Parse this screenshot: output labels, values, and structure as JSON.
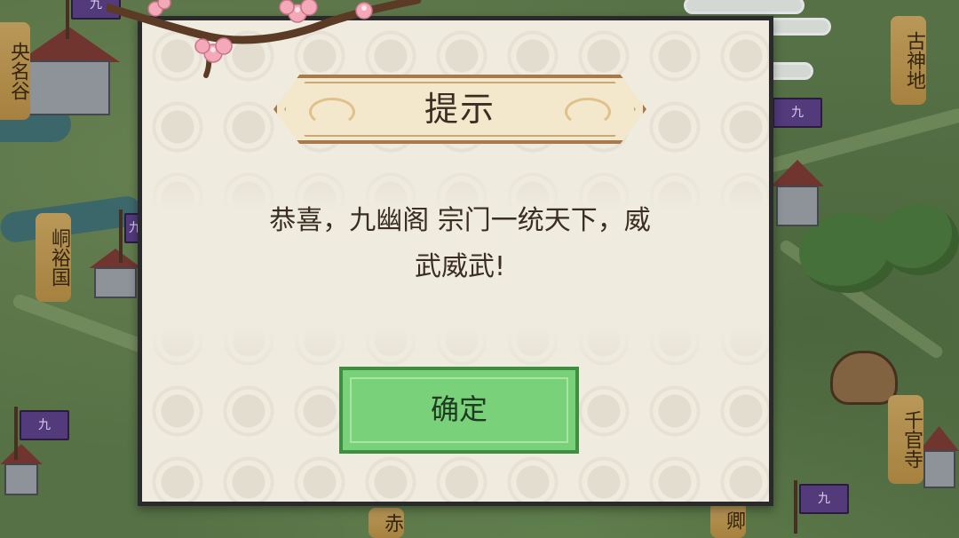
{
  "dialog": {
    "title": "提示",
    "message": "恭喜，九幽阁 宗门一统天下，威武威武!",
    "confirm_label": "确定"
  },
  "map": {
    "regions": [
      {
        "name": "央名谷"
      },
      {
        "name": "峒裕国"
      },
      {
        "name": "古神地"
      },
      {
        "name": "千官寺"
      },
      {
        "name": "赤"
      },
      {
        "name": "卿"
      }
    ],
    "flag_text": "九"
  },
  "colors": {
    "dialog_bg": "#efebdf",
    "dialog_border": "#2a2a2c",
    "button_green": "#79d17a",
    "flag_purple": "#5a3f86",
    "label_gold": "#c9a561"
  }
}
